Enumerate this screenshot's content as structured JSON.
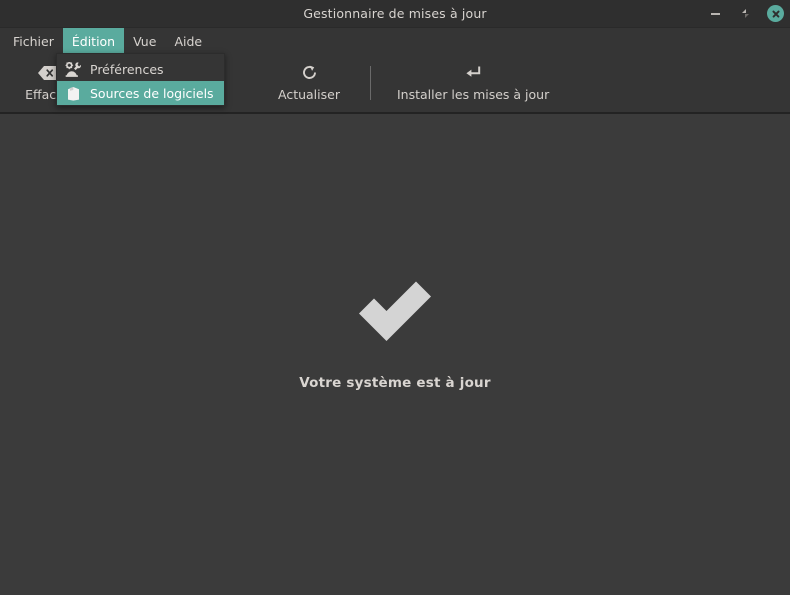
{
  "window": {
    "title": "Gestionnaire de mises à jour",
    "controls": {
      "minimize_name": "minimize-button",
      "maximize_name": "maximize-button",
      "close_name": "close-button"
    }
  },
  "menubar": {
    "items": [
      {
        "label": "Fichier",
        "active": false
      },
      {
        "label": "Édition",
        "active": true
      },
      {
        "label": "Vue",
        "active": false
      },
      {
        "label": "Aide",
        "active": false
      }
    ]
  },
  "dropdown": {
    "open_for": "Édition",
    "items": [
      {
        "label": "Préférences",
        "icon": "preferences-gear-wrench-icon",
        "selected": false
      },
      {
        "label": "Sources de logiciels",
        "icon": "package-box-icon",
        "selected": true
      }
    ]
  },
  "toolbar": {
    "buttons": [
      {
        "label": "Effacer",
        "icon": "clear-backspace-icon"
      },
      {
        "label": "Actualiser",
        "icon": "refresh-icon"
      },
      {
        "label": "Installer les mises à jour",
        "icon": "enter-arrow-icon"
      }
    ]
  },
  "content": {
    "status_icon": "checkmark-icon",
    "status_text": "Votre système est à jour"
  },
  "colors": {
    "accent": "#5aab9e",
    "titlebar_bg": "#2f2f2f",
    "toolbar_bg": "#353535",
    "content_bg": "#3b3b3b",
    "text": "#d7d3cf",
    "checkmark": "#d4d4d4"
  }
}
